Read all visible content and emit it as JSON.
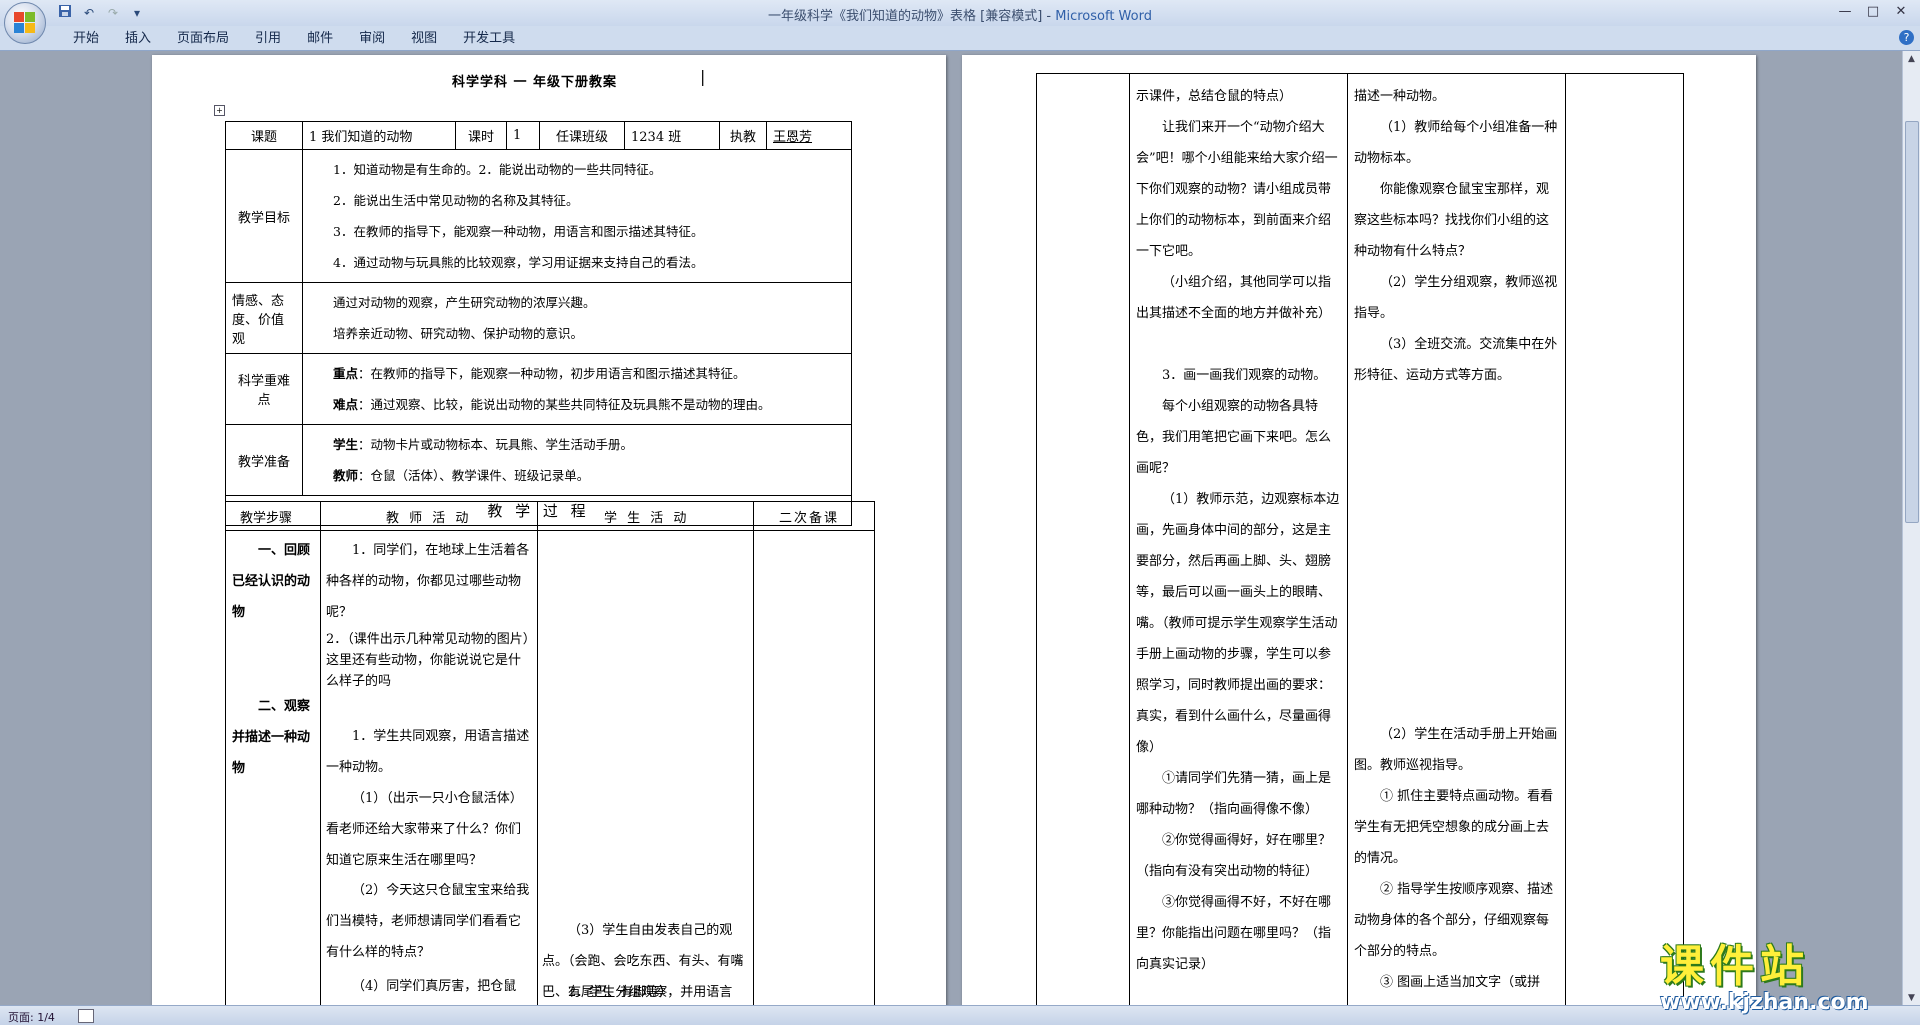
{
  "window": {
    "title_doc": "一年级科学《我们知道的动物》表格 [兼容模式] - ",
    "title_app": "Microsoft Word",
    "min": "—",
    "max": "□",
    "close": "✕"
  },
  "qat": {
    "save_icon": "save-icon",
    "undo": "↶",
    "redo": "↷",
    "more": "▾"
  },
  "ribbon": {
    "tabs": [
      "开始",
      "插入",
      "页面布局",
      "引用",
      "邮件",
      "审阅",
      "视图",
      "开发工具"
    ],
    "help": "?"
  },
  "page1": {
    "heading": "科学学科 一 年级下册教案",
    "cursor": "|",
    "row1": {
      "label": "课题",
      "title": "1 我们知道的动物",
      "hours_label": "课时",
      "hours": "1",
      "class_label": "任课班级",
      "class": "1234 班",
      "teacher_label": "执教",
      "teacher": "王恩芳"
    },
    "goals_label": "教学目标",
    "goals": [
      "1．知道动物是有生命的。2．能说出动物的一些共同特征。",
      "2．能说出生活中常见动物的名称及其特征。",
      "3．在教师的指导下，能观察一种动物，用语言和图示描述其特征。",
      "4．通过动物与玩具熊的比较观察，学习用证据来支持自己的看法。"
    ],
    "attitude_label": "情感、态度、价值观",
    "attitude": [
      "通过对动物的观察，产生研究动物的浓厚兴趣。",
      "培养亲近动物、研究动物、保护动物的意识。"
    ],
    "key_label": "科学重难点",
    "key_focus_label": "重点",
    "key_focus": "：在教师的指导下，能观察一种动物，初步用语言和图示描述其特征。",
    "key_hard_label": "难点",
    "key_hard": "：通过观察、比较，能说出动物的某些共同特征及玩具熊不是动物的理由。",
    "prep_label": "教学准备",
    "prep_student_label": "学生",
    "prep_student": "：动物卡片或动物标本、玩具熊、学生活动手册。",
    "prep_teacher_label": "教师",
    "prep_teacher": "：仓鼠（活体）、教学课件、班级记录单。",
    "process_title": "教 学 过 程",
    "col_steps": "教学步骤",
    "col_teacher": "教 师 活 动",
    "col_student": "学 生 活 动",
    "col_notes": "二次备课",
    "step1": "一、回顾已经认识的动物",
    "step2": "二、观察并描述一种动物",
    "teacher_lines": [
      "1．同学们，在地球上生活着各种各样的动物，你都见过哪些动物呢？",
      "2．（课件出示几种常见动物的图片）这里还有些动物，你能说说它是什么样子的吗",
      "1．学生共同观察，用语言描述一种动物。",
      "（1）（出示一只小仓鼠活体）看老师还给大家带来了什么？你们知道它原来生活在哪里吗？",
      "（2）今天这只仓鼠宝宝来给我们当模特，老师想请同学们看看它有什么样的特点？",
      "（4）同学们真厉害，把仓鼠"
    ],
    "student_lines": [
      "（3）学生自由发表自己的观点。（会跑、会吃东西、有头、有嘴巴、有尾巴、有脚等）",
      "2．学生分组观察，并用语言"
    ]
  },
  "page2": {
    "teacher_lines": [
      "示课件，总结仓鼠的特点）",
      "让我们来开一个“动物介绍大会”吧！哪个小组能来给大家介绍一下你们观察的动物？请小组成员带上你们的动物标本，到前面来介绍一下它吧。",
      "（小组介绍，其他同学可以指出其描述不全面的地方并做补充）",
      "3．画一画我们观察的动物。",
      "每个小组观察的动物各具特色，我们用笔把它画下来吧。怎么画呢？",
      "（1）教师示范，边观察标本边画，先画身体中间的部分，这是主要部分，然后再画上脚、头、翅膀等，最后可以画一画头上的眼睛、嘴。（教师可提示学生观察学生活动手册上画动物的步骤，学生可以参照学习，同时教师提出画的要求：真实，看到什么画什么，尽量画得像）",
      "①请同学们先猜一猜，画上是哪种动物？（指向画得像不像）",
      "②你觉得画得好，好在哪里？（指向有没有突出动物的特征）",
      "③你觉得画得不好，不好在哪里？你能指出问题在哪里吗？（指向真实记录）"
    ],
    "student_lines": [
      "描述一种动物。",
      "（1）教师给每个小组准备一种动物标本。",
      "你能像观察仓鼠宝宝那样，观察这些标本吗？找找你们小组的这种动物有什么特点？",
      "（2）学生分组观察，教师巡视指导。",
      "（3）全班交流。交流集中在外形特征、运动方式等方面。",
      "（2）学生在活动手册上开始画图。教师巡视指导。",
      "① 抓住主要特点画动物。看看学生有无把凭空想象的成分画上去的情况。",
      "② 指导学生按顺序观察、描述动物身体的各个部分，仔细观察每个部分的特点。",
      "③ 图画上适当加文字（或拼"
    ]
  },
  "status": {
    "page": "页面: 1/4"
  },
  "watermark": {
    "main": "课件站",
    "url": "www.kjzhan.com"
  },
  "colors": {
    "ribbon_bg": "#cfdcee",
    "title_app": "#2f5fa8",
    "workspace": "#9aa4b4",
    "wm_yellow": "#ffef3a",
    "wm_green": "#2d7a1b"
  }
}
